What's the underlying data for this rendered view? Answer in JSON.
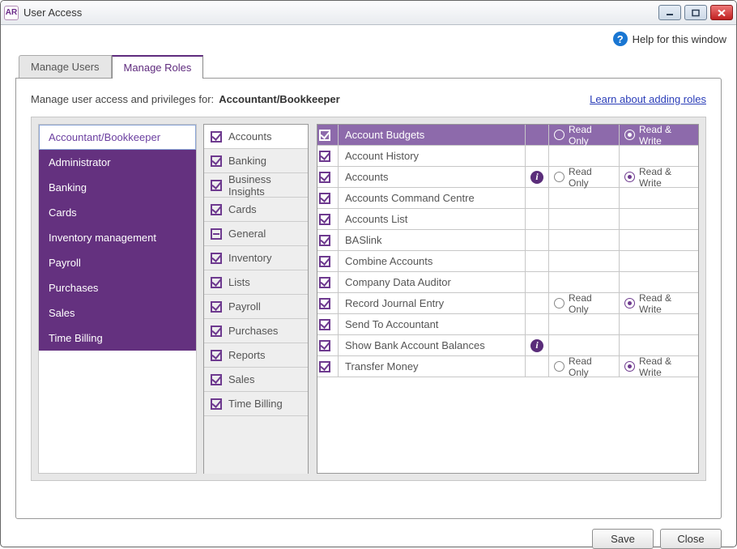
{
  "window": {
    "app_icon": "AR",
    "title": "User Access"
  },
  "help": {
    "label": "Help for this window"
  },
  "tabs": [
    {
      "label": "Manage Users",
      "active": false
    },
    {
      "label": "Manage Roles",
      "active": true
    }
  ],
  "heading": {
    "prefix": "Manage user access and privileges for:",
    "role": "Accountant/Bookkeeper",
    "learn_link": "Learn about adding roles"
  },
  "roles": [
    {
      "label": "Accountant/Bookkeeper",
      "selected": true
    },
    {
      "label": "Administrator"
    },
    {
      "label": "Banking"
    },
    {
      "label": "Cards"
    },
    {
      "label": "Inventory management"
    },
    {
      "label": "Payroll"
    },
    {
      "label": "Purchases"
    },
    {
      "label": "Sales"
    },
    {
      "label": "Time Billing"
    }
  ],
  "categories": [
    {
      "label": "Accounts",
      "state": "checked",
      "active": true
    },
    {
      "label": "Banking",
      "state": "checked"
    },
    {
      "label": "Business Insights",
      "state": "checked"
    },
    {
      "label": "Cards",
      "state": "checked"
    },
    {
      "label": "General",
      "state": "partial"
    },
    {
      "label": "Inventory",
      "state": "checked"
    },
    {
      "label": "Lists",
      "state": "checked"
    },
    {
      "label": "Payroll",
      "state": "checked"
    },
    {
      "label": "Purchases",
      "state": "checked"
    },
    {
      "label": "Reports",
      "state": "checked"
    },
    {
      "label": "Sales",
      "state": "checked"
    },
    {
      "label": "Time Billing",
      "state": "checked"
    }
  ],
  "perm_header": {
    "name": "Account Budgets",
    "read_only": "Read Only",
    "read_write": "Read & Write"
  },
  "radio_labels": {
    "ro": "Read Only",
    "rw": "Read & Write"
  },
  "permissions": [
    {
      "label": "Account History",
      "checked": true
    },
    {
      "label": "Accounts",
      "checked": true,
      "info": true,
      "show_radios": true,
      "rw": true
    },
    {
      "label": "Accounts Command Centre",
      "checked": true
    },
    {
      "label": "Accounts List",
      "checked": true
    },
    {
      "label": "BASlink",
      "checked": true
    },
    {
      "label": "Combine Accounts",
      "checked": true
    },
    {
      "label": "Company Data Auditor",
      "checked": true
    },
    {
      "label": "Record Journal Entry",
      "checked": true,
      "show_radios": true,
      "rw": true
    },
    {
      "label": "Send To Accountant",
      "checked": true
    },
    {
      "label": "Show Bank Account Balances",
      "checked": true,
      "info": true
    },
    {
      "label": "Transfer Money",
      "checked": true,
      "show_radios": true,
      "rw": true
    }
  ],
  "footer": {
    "save": "Save",
    "close": "Close"
  }
}
